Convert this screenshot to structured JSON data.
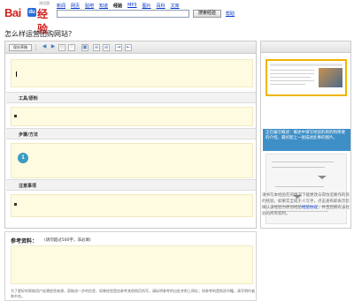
{
  "header": {
    "logo": {
      "bai": "Bai",
      "du": "du",
      "jingyan": "经验",
      "beta": "测试版"
    },
    "nav": [
      "新闻",
      "网页",
      "贴吧",
      "知道",
      "经验",
      "MP3",
      "图片",
      "百科",
      "文库"
    ],
    "nav_active_index": 4,
    "search": {
      "value": "",
      "button_label": "搜索经验"
    },
    "help_label": "帮助"
  },
  "page": {
    "title": "怎么样运营团购网站？"
  },
  "editor": {
    "toolbar": {
      "save_draft_label": "保存草稿",
      "tools": [
        "undo-icon",
        "redo-icon",
        "bold-icon",
        "italic-icon",
        "insert-image-icon",
        "ordered-list-icon",
        "unordered-list-icon",
        "indent-icon",
        "outdent-icon"
      ]
    },
    "sections": [
      {
        "key": "tools",
        "label": "工具/原料"
      },
      {
        "key": "steps",
        "label": "步骤/方法",
        "step_number": "1"
      },
      {
        "key": "notes",
        "label": "注意事项"
      }
    ]
  },
  "references": {
    "title": "参考资料：",
    "hint": "(请勿超过500字，非必填)",
    "note": "为了更好的帮助用户追溯经验来源，获取进一步的信息，如果经验是由参考其他网页所写，请标明参考的出处并附上网址；如参考的是纸质书籍，请写明作者和书名。"
  },
  "guide": {
    "callout": "正在编写概述：概述中请写经验的目的和简要的介绍，最好配上一张描述此事的图片。",
    "text_before_link": "请书写本经验在的情况下能更改与得仿造要作的资的经验，如果实全成于人写手，点击发布即表示您确认该经验为原创经验",
    "link_label": "经验协议",
    "text_after_link": "，并且您拥有该经验的所有权利。"
  },
  "colors": {
    "brand_red": "#d21e1e",
    "brand_blue": "#2b6bd6",
    "link_blue": "#0033cc",
    "input_yellow": "#fffbe0",
    "callout_blue": "#3f8fc7",
    "highlight_orange": "#f0b400",
    "step_teal": "#3c9cc0"
  }
}
